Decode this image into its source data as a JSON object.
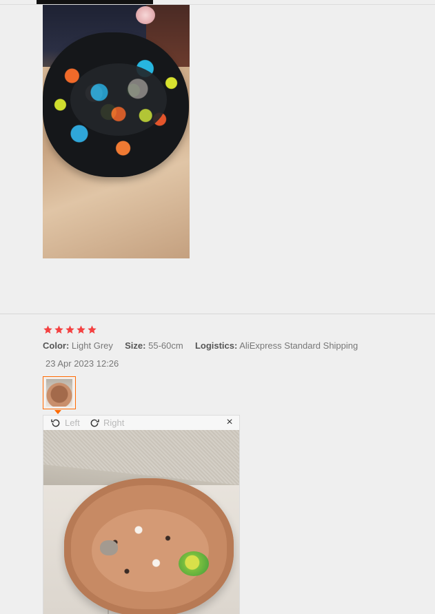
{
  "review": {
    "rating": 5,
    "rating_max": 5,
    "star_color": "#f44141",
    "color_label": "Color:",
    "color_value": "Light Grey",
    "size_label": "Size:",
    "size_value": "55-60cm",
    "logistics_label": "Logistics:",
    "logistics_value": "AliExpress Standard Shipping",
    "date": "23 Apr 2023 12:26"
  },
  "viewer": {
    "rotate_left_label": "Left",
    "rotate_right_label": "Right",
    "close_glyph": "×",
    "accent_color": "#ff6a00"
  },
  "icons": {
    "rotate_left": "rotate-left-icon",
    "rotate_right": "rotate-right-icon",
    "close": "close-icon",
    "star": "star-icon"
  }
}
